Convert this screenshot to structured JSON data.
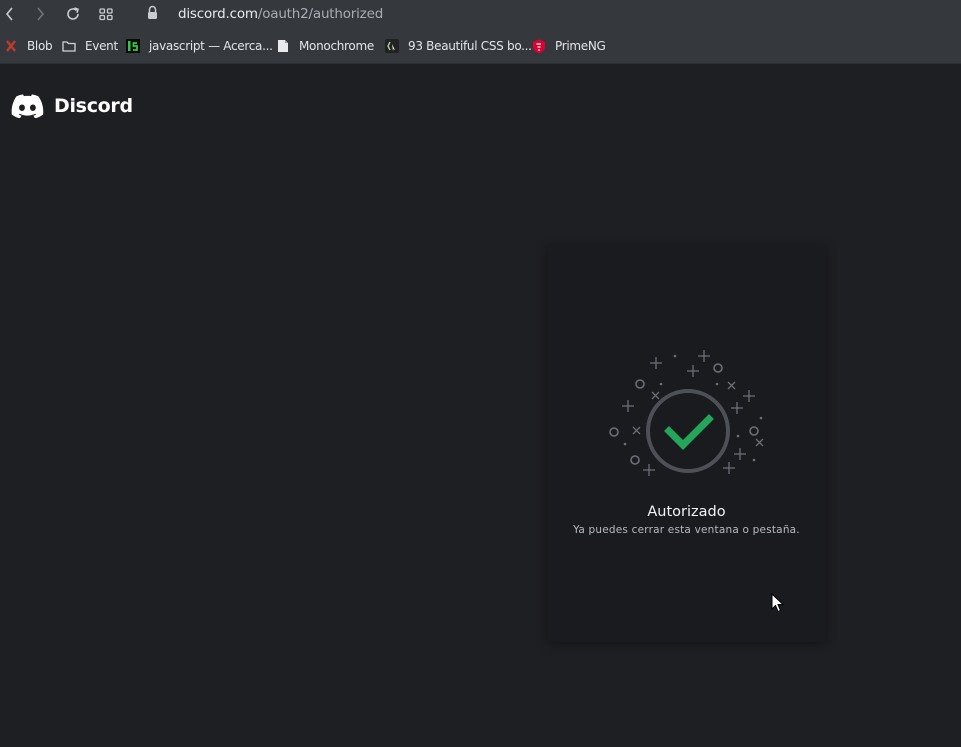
{
  "browser": {
    "url_host": "discord.com",
    "url_path": "/oauth2/authorized",
    "bookmarks": [
      {
        "label": "Blob",
        "icon": "blob-icon"
      },
      {
        "label": "Event",
        "icon": "folder-icon"
      },
      {
        "label": "javascript — Acerca...",
        "icon": "js-site-icon"
      },
      {
        "label": "Monochrome",
        "icon": "document-icon"
      },
      {
        "label": "93 Beautiful CSS bo...",
        "icon": "css-site-icon"
      },
      {
        "label": "PrimeNG",
        "icon": "primeng-icon"
      }
    ]
  },
  "page": {
    "brand": "Discord",
    "title": "Autorizado",
    "subtitle": "Ya puedes cerrar esta ventana o pestaña.",
    "colors": {
      "background": "#1e1f22",
      "card": "#1a1b1e",
      "success": "#23a55a",
      "ring": "#4e5058"
    }
  }
}
